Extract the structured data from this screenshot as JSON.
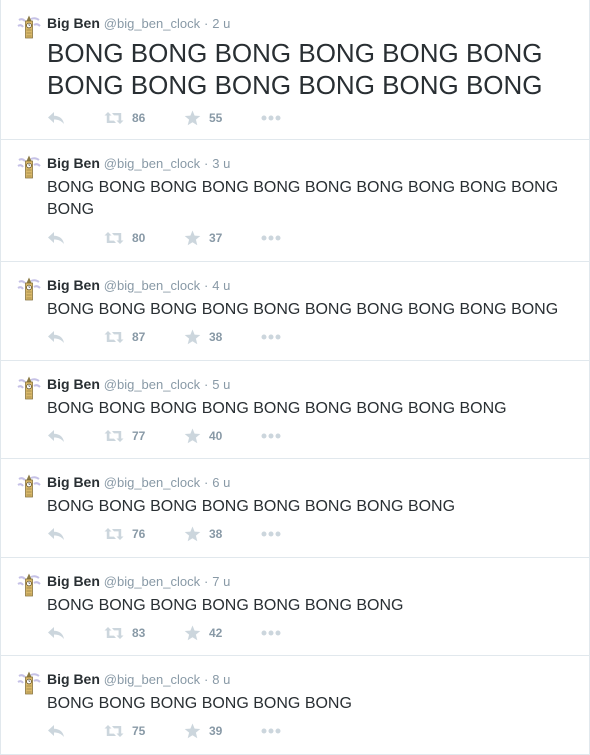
{
  "feed": {
    "tweets": [
      {
        "name": "Big Ben",
        "handle": "@big_ben_clock",
        "time": "2 u",
        "text": "BONG BONG BONG BONG BONG BONG BONG BONG BONG BONG BONG BONG",
        "retweets": "86",
        "favorites": "55"
      },
      {
        "name": "Big Ben",
        "handle": "@big_ben_clock",
        "time": "3 u",
        "text": "BONG BONG BONG BONG BONG BONG BONG BONG BONG BONG BONG",
        "retweets": "80",
        "favorites": "37"
      },
      {
        "name": "Big Ben",
        "handle": "@big_ben_clock",
        "time": "4 u",
        "text": "BONG BONG BONG BONG BONG BONG BONG BONG BONG BONG",
        "retweets": "87",
        "favorites": "38"
      },
      {
        "name": "Big Ben",
        "handle": "@big_ben_clock",
        "time": "5 u",
        "text": "BONG BONG BONG BONG BONG BONG BONG BONG BONG",
        "retweets": "77",
        "favorites": "40"
      },
      {
        "name": "Big Ben",
        "handle": "@big_ben_clock",
        "time": "6 u",
        "text": "BONG BONG BONG BONG BONG BONG BONG BONG",
        "retweets": "76",
        "favorites": "38"
      },
      {
        "name": "Big Ben",
        "handle": "@big_ben_clock",
        "time": "7 u",
        "text": "BONG BONG BONG BONG BONG BONG BONG",
        "retweets": "83",
        "favorites": "42"
      },
      {
        "name": "Big Ben",
        "handle": "@big_ben_clock",
        "time": "8 u",
        "text": "BONG BONG BONG BONG BONG BONG",
        "retweets": "75",
        "favorites": "39"
      }
    ]
  },
  "icons": {
    "reply": "reply-icon",
    "retweet": "retweet-icon",
    "favorite": "star-icon",
    "more": "more-icon",
    "avatar": "big-ben-tower-icon"
  },
  "colors": {
    "text": "#292f33",
    "muted": "#8899a6",
    "icon": "#ccd6dd",
    "border": "#e1e8ed"
  }
}
